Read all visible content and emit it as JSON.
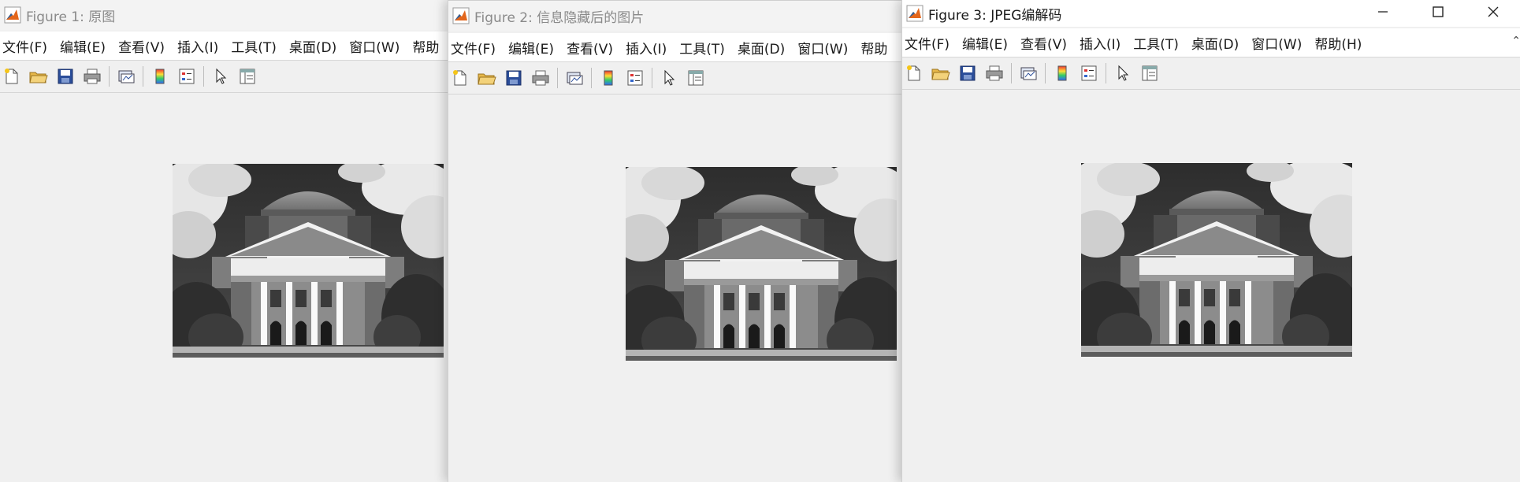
{
  "windows": [
    {
      "title": "Figure 1: 原图",
      "menus": [
        "文件(F)",
        "编辑(E)",
        "查看(V)",
        "插入(I)",
        "工具(T)",
        "桌面(D)",
        "窗口(W)",
        "帮助"
      ],
      "active": false,
      "image": "grayscale-building-photo"
    },
    {
      "title": "Figure 2: 信息隐藏后的图片",
      "menus": [
        "文件(F)",
        "编辑(E)",
        "查看(V)",
        "插入(I)",
        "工具(T)",
        "桌面(D)",
        "窗口(W)",
        "帮助"
      ],
      "active": false,
      "image": "grayscale-building-photo"
    },
    {
      "title": "Figure 3: JPEG编解码",
      "menus": [
        "文件(F)",
        "编辑(E)",
        "查看(V)",
        "插入(I)",
        "工具(T)",
        "桌面(D)",
        "窗口(W)",
        "帮助(H)"
      ],
      "active": true,
      "image": "grayscale-building-photo",
      "controls": [
        "minimize-icon",
        "maximize-icon",
        "close-icon"
      ]
    }
  ],
  "toolbar_icons": [
    "new-figure-icon",
    "open-file-icon",
    "save-icon",
    "print-icon",
    "link-plot-icon",
    "colorbar-icon",
    "legend-icon",
    "select-pointer-icon",
    "property-inspector-icon"
  ],
  "colors": {
    "titlebar_inactive_text": "#8a8a8a",
    "titlebar_active_text": "#1a1a1a",
    "background": "#f0f0f0"
  }
}
